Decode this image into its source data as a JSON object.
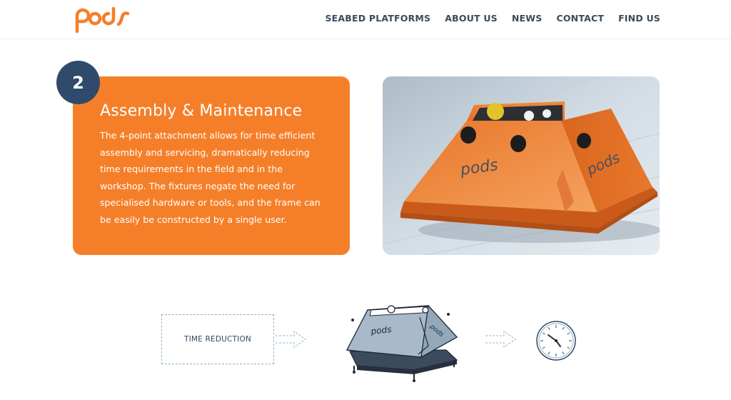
{
  "brand": {
    "logo_text": "pods",
    "accent": "#f57f29",
    "navy": "#2f4a6b"
  },
  "nav": {
    "items": [
      "SEABED PLATFORMS",
      "ABOUT US",
      "NEWS",
      "CONTACT",
      "FIND US"
    ]
  },
  "feature": {
    "step": "2",
    "title": "Assembly & Maintenance",
    "body": "The 4-point attachment allows for time efficient assembly and servicing, dramatically reducing time requirements in the field and in the workshop. The fixtures negate the need for specialised hardware or tools, and the frame can be easily be constructed by a single user."
  },
  "photo": {
    "product_logo": "pods"
  },
  "diagram": {
    "label": "TIME REDUCTION",
    "icons": [
      "dashed-arrow-icon",
      "pod-frame-drawing",
      "dashed-arrow-icon",
      "clock-icon"
    ]
  }
}
